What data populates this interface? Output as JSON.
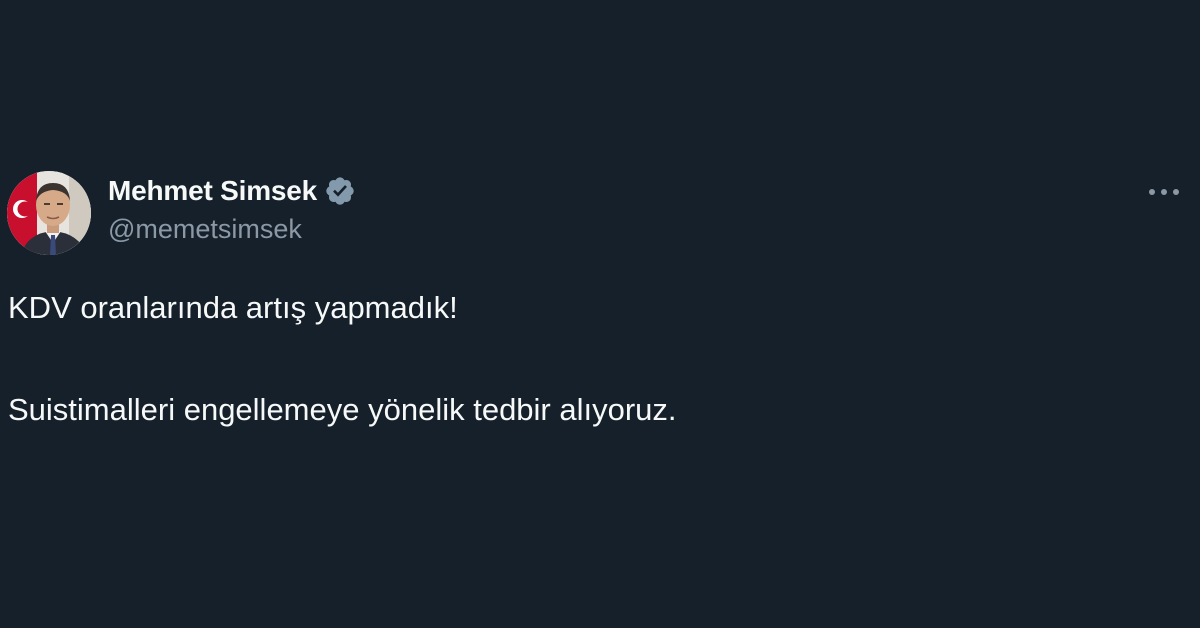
{
  "tweet": {
    "author": {
      "display_name": "Mehmet Simsek",
      "handle": "@memetsimsek",
      "verified": true,
      "verified_badge_icon": "verified-badge-icon",
      "avatar": "avatar-photo"
    },
    "menu_icon": "more-options-icon",
    "text_lines": [
      "KDV oranlarında artış yapmadık!",
      "Suistimalleri engellemeye yönelik tedbir alıyoruz."
    ]
  },
  "colors": {
    "background": "#15202b",
    "text_primary": "#f7f9f9",
    "text_secondary": "#8b98a5",
    "verified_badge": "#829aab"
  }
}
